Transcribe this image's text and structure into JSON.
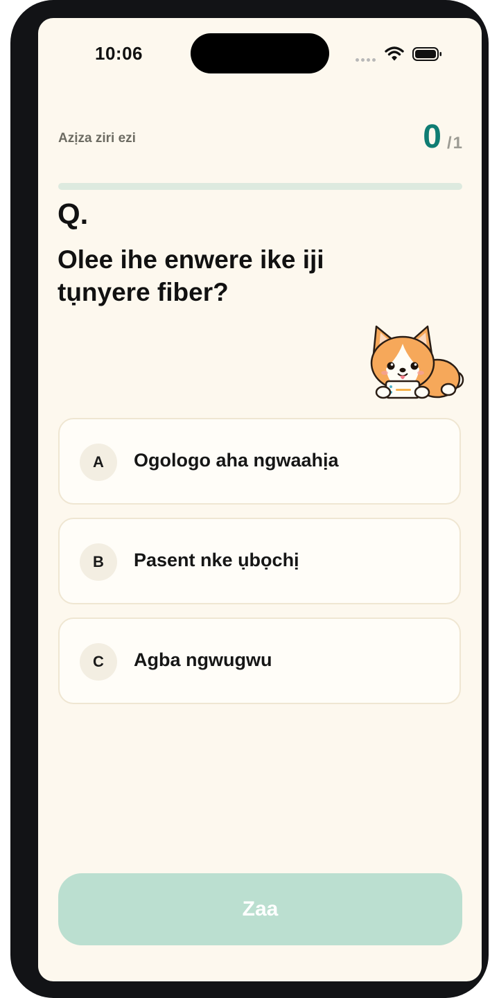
{
  "status_bar": {
    "time": "10:06",
    "icons": [
      "cellular-dots-icon",
      "wifi-icon",
      "battery-icon"
    ]
  },
  "header": {
    "label": "Azịza ziri ezi",
    "score_current": "0",
    "score_separator": "/",
    "score_total": "1",
    "progress_fraction": 0
  },
  "question": {
    "marker": "Q.",
    "text": "Olee ihe enwere ike iji tụnyere fiber?"
  },
  "mascot": {
    "icon": "corgi-mascot-icon"
  },
  "options": [
    {
      "letter": "A",
      "text": "Ogologo aha ngwaahịa"
    },
    {
      "letter": "B",
      "text": "Pasent nke ụbọchị"
    },
    {
      "letter": "C",
      "text": "Agba ngwugwu"
    }
  ],
  "submit": {
    "label": "Zaa"
  },
  "colors": {
    "background": "#fdf8ee",
    "accent": "#0f7d73",
    "submit_disabled": "#bbdfd0",
    "progress_track": "#ddeadf"
  }
}
